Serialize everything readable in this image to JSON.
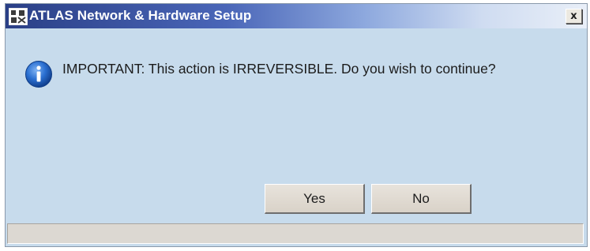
{
  "window": {
    "title": "ATLAS Network & Hardware Setup",
    "close_label": "x",
    "app_icon": "atlas-app-icon"
  },
  "dialog": {
    "icon": "info-icon",
    "message": "IMPORTANT: This action is IRREVERSIBLE. Do you wish to continue?",
    "yes_label": "Yes",
    "no_label": "No"
  },
  "status_bar": {
    "text": ""
  },
  "colors": {
    "title_gradient_start": "#2a3f86",
    "title_gradient_end": "#e9eff8",
    "dialog_background": "#c7dbec",
    "button_face": "#e0dad2",
    "info_icon_blue": "#2a6fd1"
  }
}
